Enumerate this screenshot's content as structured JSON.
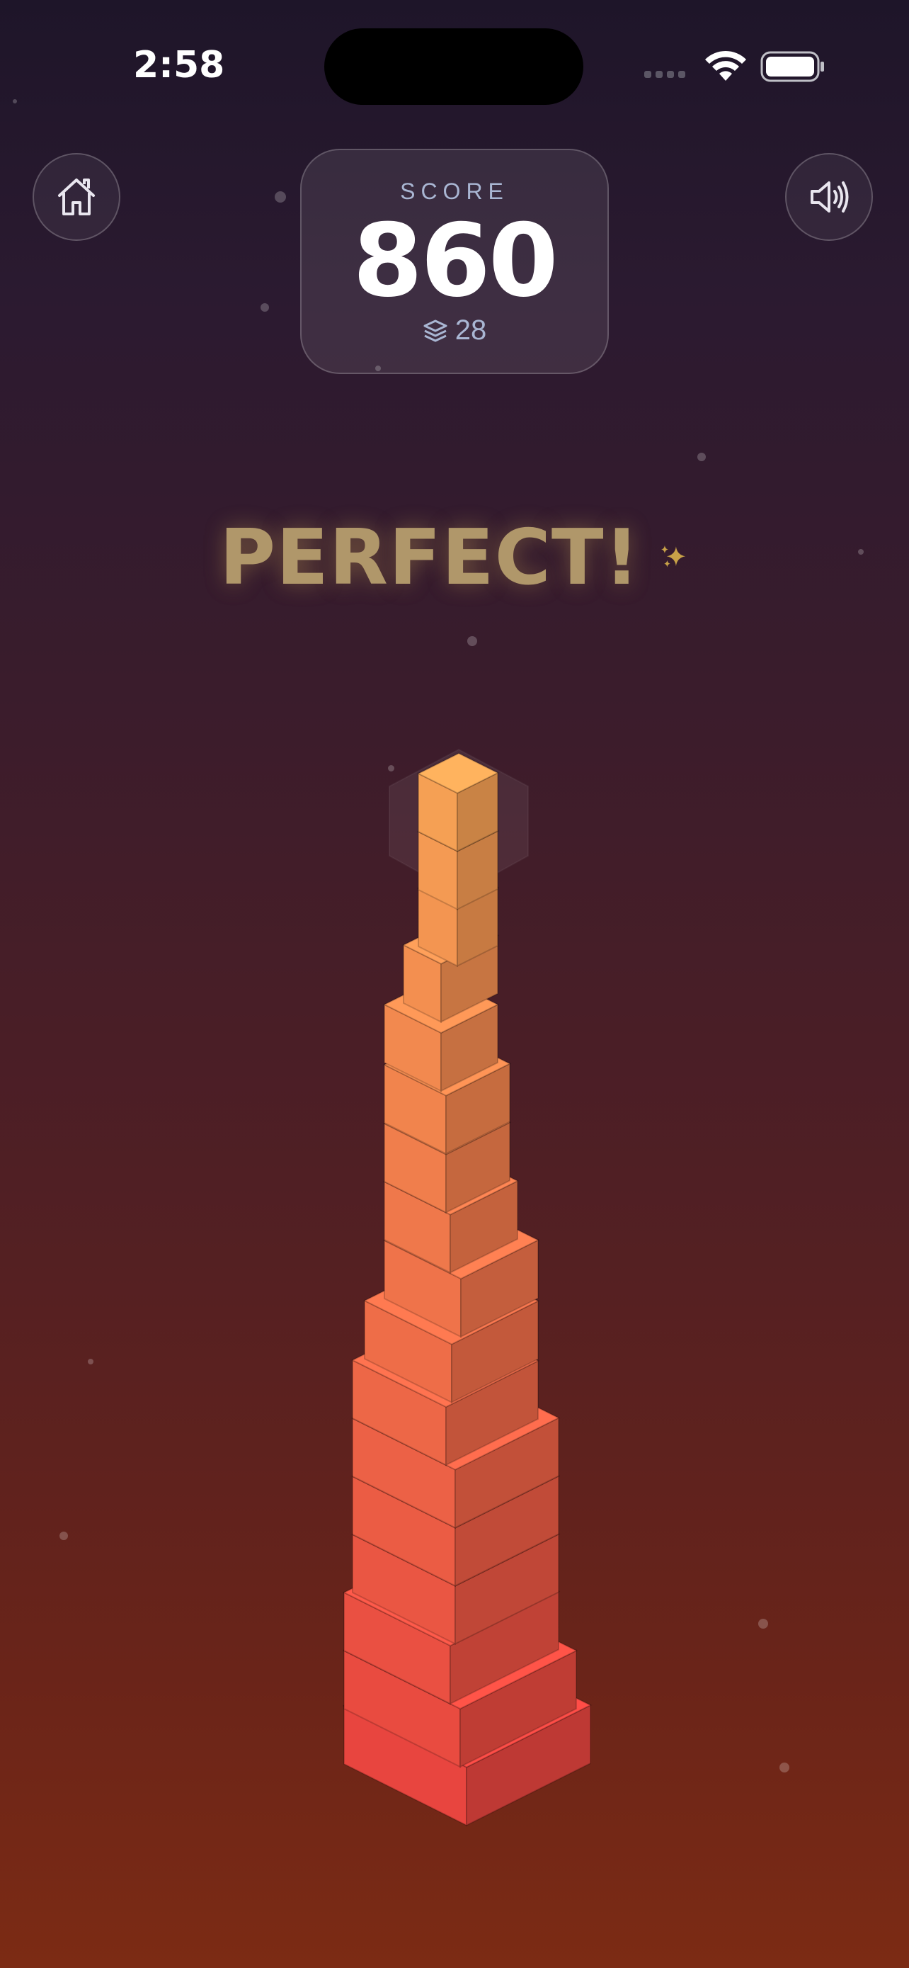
{
  "status_bar": {
    "time": "2:58"
  },
  "hud": {
    "home_icon": "home-icon",
    "sound_icon": "speaker-wave-icon",
    "score_label": "SCORE",
    "score": "860",
    "layers_icon": "layers-icon",
    "layers": "28"
  },
  "banner": {
    "text": "PERFECT!",
    "icon": "sparkles-icon"
  },
  "colors": {
    "accent": "#f0913a",
    "banner_gold": "#b0976a",
    "tower_top": "#f5a054",
    "tower_bottom": "#e8453f"
  }
}
